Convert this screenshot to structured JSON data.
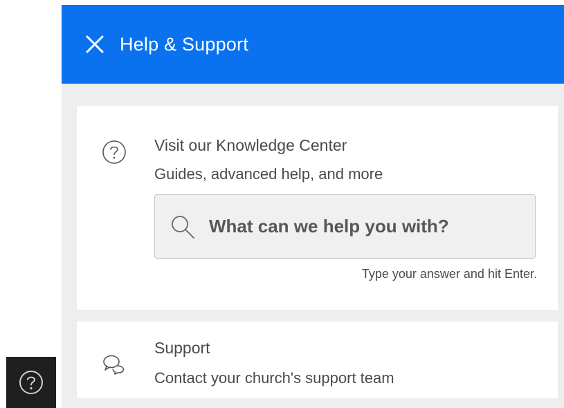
{
  "header": {
    "title": "Help & Support",
    "close_icon": "close-icon",
    "background": "#0a72ef"
  },
  "knowledge_center": {
    "icon": "question-circle-icon",
    "title": "Visit our Knowledge Center",
    "subtitle": "Guides, advanced help, and more",
    "search": {
      "placeholder": "What can we help you with?",
      "value": "",
      "icon": "search-icon"
    },
    "hint": "Type your answer and hit Enter."
  },
  "support": {
    "icon": "chat-bubbles-icon",
    "title": "Support",
    "subtitle": "Contact your church's support team"
  },
  "launcher": {
    "icon": "help-circle-icon"
  }
}
